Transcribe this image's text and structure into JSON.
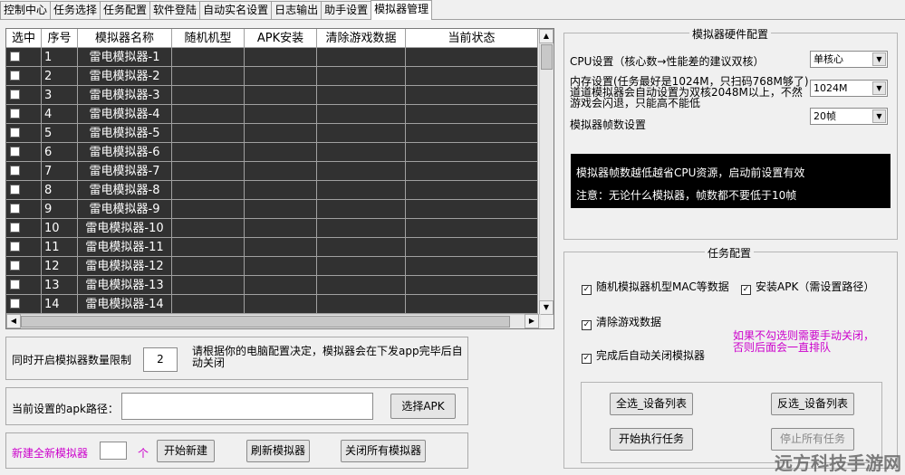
{
  "tabs": [
    "控制中心",
    "任务选择",
    "任务配置",
    "软件登陆",
    "自动实名设置",
    "日志输出",
    "助手设置",
    "模拟器管理"
  ],
  "grid": {
    "headers": [
      "选中",
      "序号",
      "模拟器名称",
      "随机机型",
      "APK安装",
      "清除游戏数据",
      "当前状态"
    ],
    "rows": [
      {
        "no": "1",
        "name": "雷电模拟器-1"
      },
      {
        "no": "2",
        "name": "雷电模拟器-2"
      },
      {
        "no": "3",
        "name": "雷电模拟器-3"
      },
      {
        "no": "4",
        "name": "雷电模拟器-4"
      },
      {
        "no": "5",
        "name": "雷电模拟器-5"
      },
      {
        "no": "6",
        "name": "雷电模拟器-6"
      },
      {
        "no": "7",
        "name": "雷电模拟器-7"
      },
      {
        "no": "8",
        "name": "雷电模拟器-8"
      },
      {
        "no": "9",
        "name": "雷电模拟器-9"
      },
      {
        "no": "10",
        "name": "雷电模拟器-10"
      },
      {
        "no": "11",
        "name": "雷电模拟器-11"
      },
      {
        "no": "12",
        "name": "雷电模拟器-12"
      },
      {
        "no": "13",
        "name": "雷电模拟器-13"
      },
      {
        "no": "14",
        "name": "雷电模拟器-14"
      }
    ]
  },
  "limit": {
    "label": "同时开启模拟器数量限制",
    "value": "2",
    "hint": "请根据你的电脑配置决定，模拟器会在下发app完毕后自动关闭"
  },
  "apk": {
    "label": "当前设置的apk路径：",
    "value": "",
    "button": "选择APK"
  },
  "create": {
    "label": "新建全新模拟器",
    "count": "",
    "unit": "个",
    "start": "开始新建",
    "refresh": "刷新模拟器",
    "close_all": "关闭所有模拟器"
  },
  "hw": {
    "title": "模拟器硬件配置",
    "cpu_label": "CPU设置（核心数→性能差的建议双核）",
    "cpu_value": "单核心",
    "mem_label": "内存设置(任务最好是1024M，只扫码768M够了)",
    "mem_label2": "道道模拟器会自动设置为双核2048M以上，不然",
    "mem_label3": "游戏会闪退，只能高不能低",
    "mem_value": "1024M",
    "fps_label": "模拟器帧数设置",
    "fps_value": "20帧",
    "notice1": "模拟器帧数越低越省CPU资源，启动前设置有效",
    "notice2": "注意：无论什么模拟器，帧数都不要低于10帧"
  },
  "task": {
    "title": "任务配置",
    "cb1": "随机模拟器机型MAC等数据",
    "cb2": "安装APK（需设置路径）",
    "cb3": "清除游戏数据",
    "cb4": "完成后自动关闭模拟器",
    "note1": "如果不勾选则需要手动关闭，",
    "note2": "否则后面会一直排队",
    "btn_select_all": "全选_设备列表",
    "btn_invert": "反选_设备列表",
    "btn_run": "开始执行任务",
    "btn_stop": "停止所有任务"
  },
  "colors": {
    "accent_magenta": "#cc00cc",
    "grid_bg": "#313131"
  },
  "watermark": "远方科技手游网"
}
